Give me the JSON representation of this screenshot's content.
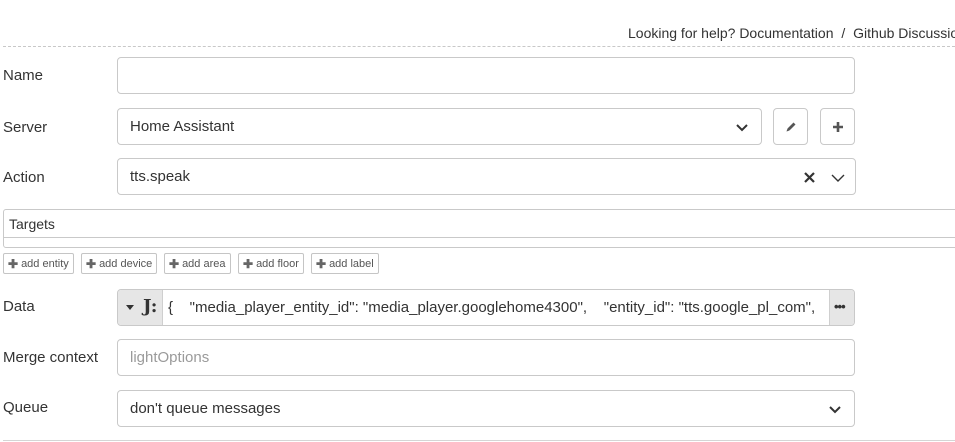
{
  "help": {
    "prefix": "Looking for help?",
    "documentation": "Documentation",
    "separator": "/",
    "github": "Github Discussions"
  },
  "form": {
    "name": {
      "label": "Name",
      "value": ""
    },
    "server": {
      "label": "Server",
      "value": "Home Assistant"
    },
    "action": {
      "label": "Action",
      "value": "tts.speak"
    },
    "targets": {
      "header": "Targets",
      "buttons": [
        "add entity",
        "add device",
        "add area",
        "add floor",
        "add label"
      ]
    },
    "data": {
      "label": "Data",
      "value": "{    \"media_player_entity_id\": \"media_player.googlehome4300\",    \"entity_id\": \"tts.google_pl_com\","
    },
    "merge_context": {
      "label": "Merge context",
      "placeholder": "lightOptions"
    },
    "queue": {
      "label": "Queue",
      "value": "don't queue messages"
    }
  },
  "icons": {
    "edit": "pencil-icon",
    "add": "plus-icon",
    "clear": "close-icon",
    "dropdown": "chevron-down-icon",
    "type": "jsonata-icon",
    "expand": "ellipsis-icon"
  }
}
